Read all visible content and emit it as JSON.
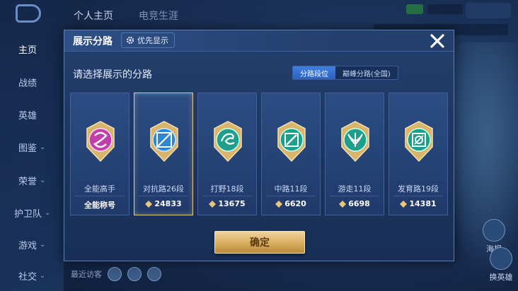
{
  "background": {
    "nav_items": [
      {
        "label": "主页",
        "active": true,
        "chevron": false
      },
      {
        "label": "战绩",
        "active": false,
        "chevron": false
      },
      {
        "label": "英雄",
        "active": false,
        "chevron": false
      },
      {
        "label": "图鉴",
        "active": false,
        "chevron": true
      },
      {
        "label": "荣誉",
        "active": false,
        "chevron": true
      },
      {
        "label": "护卫队",
        "active": false,
        "chevron": true
      },
      {
        "label": "游戏",
        "active": false,
        "chevron": true
      },
      {
        "label": "社交",
        "active": false,
        "chevron": true
      }
    ],
    "top_tabs": [
      "个人主页",
      "电竞生涯"
    ],
    "right_buttons": [
      "海报",
      "换英雄"
    ],
    "bottom_label": "最近访客"
  },
  "modal": {
    "title": "展示分路",
    "priority_label": "优先显示",
    "subtitle": "请选择展示的分路",
    "toggle": {
      "options": [
        "分路段位",
        "巅峰分路(全国)"
      ],
      "selected_index": 0
    },
    "confirm_label": "确定",
    "selected_card": 1
  },
  "cards": [
    {
      "role": "全能高手",
      "score": "全能称号",
      "show_score_icon": false,
      "badge_color": "#c23ea8",
      "badge_icon": "swirl-icon",
      "selected": false
    },
    {
      "role": "对抗路26段",
      "score": "24833",
      "show_score_icon": true,
      "badge_color": "#2f86d6",
      "badge_icon": "sword-icon",
      "selected": true
    },
    {
      "role": "打野18段",
      "score": "13675",
      "show_score_icon": true,
      "badge_color": "#1f9e8c",
      "badge_icon": "dragon-icon",
      "selected": false
    },
    {
      "role": "中路11段",
      "score": "6620",
      "show_score_icon": true,
      "badge_color": "#1f9e8c",
      "badge_icon": "staff-icon",
      "selected": false
    },
    {
      "role": "游走11段",
      "score": "6698",
      "show_score_icon": true,
      "badge_color": "#1f9e8c",
      "badge_icon": "wing-icon",
      "selected": false
    },
    {
      "role": "发育路19段",
      "score": "14381",
      "show_score_icon": true,
      "badge_color": "#1f9e8c",
      "badge_icon": "target-icon",
      "selected": false
    }
  ],
  "colors": {
    "accent_blue": "#2b63c2",
    "gold": "#d9ac5e",
    "selected_border": "#e8c88c"
  }
}
